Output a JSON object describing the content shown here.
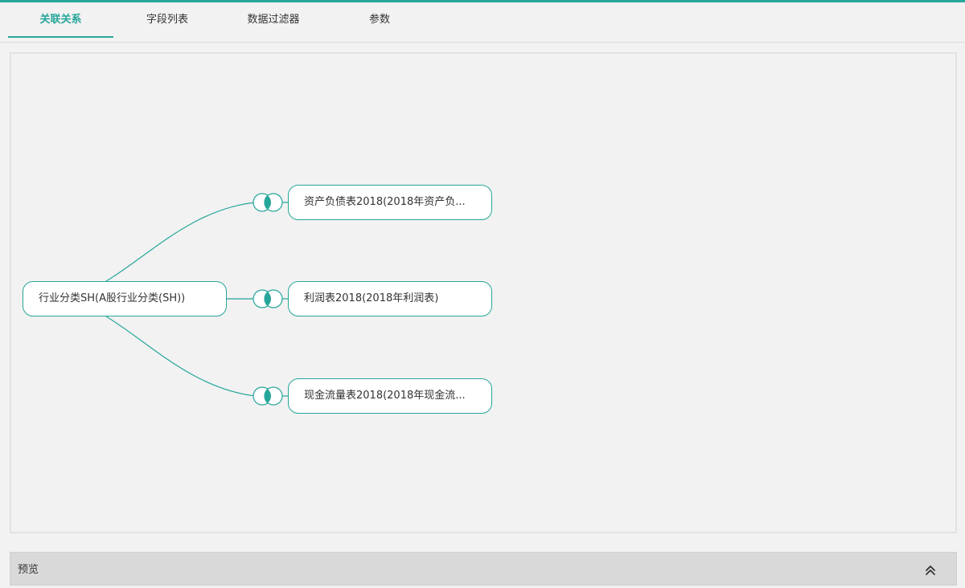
{
  "tabs": [
    {
      "label": "关联关系",
      "active": true
    },
    {
      "label": "字段列表",
      "active": false
    },
    {
      "label": "数据过滤器",
      "active": false
    },
    {
      "label": "参数",
      "active": false
    }
  ],
  "diagram": {
    "source_node": {
      "label": "行业分类SH(A股行业分类(SH))"
    },
    "target_nodes": [
      {
        "label": "资产负债表2018(2018年资产负..."
      },
      {
        "label": "利润表2018(2018年利润表)"
      },
      {
        "label": "现金流量表2018(2018年现金流..."
      }
    ],
    "join_type_icon": "inner-join-icon"
  },
  "preview": {
    "label": "预览",
    "toggle_icon": "double-chevron-up-icon"
  },
  "colors": {
    "accent": "#26a69a",
    "background": "#f2f2f2",
    "node_fill": "#ffffff",
    "preview_bar": "#d9d9d9"
  }
}
